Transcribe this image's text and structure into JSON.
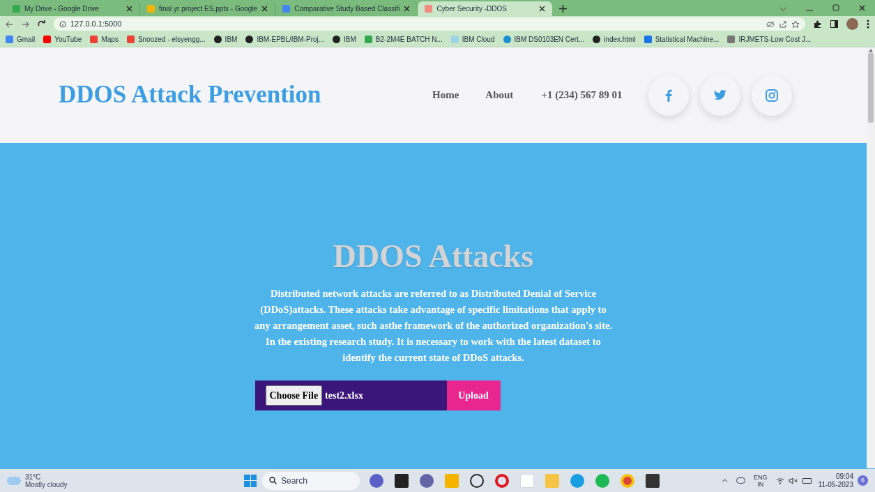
{
  "browser": {
    "tabs": [
      {
        "title": "My Drive - Google Drive",
        "selected": false
      },
      {
        "title": "final yr project ES.pptx - Google",
        "selected": false
      },
      {
        "title": "Comparative Study Based Classifi",
        "selected": false
      },
      {
        "title": "Cyber Security -DDOS",
        "selected": true
      }
    ],
    "address": "127.0.0.1:5000",
    "bookmarks": [
      "Gmail",
      "YouTube",
      "Maps",
      "Snoozed - elsyengg...",
      "IBM",
      "IBM-EPBL/IBM-Proj...",
      "IBM",
      "B2-2M4E BATCH N...",
      "IBM Cloud",
      "IBM DS0103EN Cert...",
      "index.html",
      "Statistical Machine...",
      "IRJMETS-Low Cost J..."
    ]
  },
  "header": {
    "brand": "DDOS Attack Prevention",
    "nav": [
      "Home",
      "About",
      "+1 (234) 567 89 01"
    ]
  },
  "hero": {
    "title": "DDOS Attacks",
    "text": "Distributed network attacks are referred to as Distributed Denial of Service (DDoS)attacks. These attacks take advantage of specific limitations that apply to any arrangement asset, such asthe framework of the authorized organization's site. In the existing research study. It is necessary to work with the latest dataset to identify the current state of DDoS attacks.",
    "file_button": "Choose File",
    "file_name": "test2.xlsx",
    "upload": "Upload"
  },
  "taskbar": {
    "temperature": "31°C",
    "weather": "Mostly cloudy",
    "search": "Search",
    "lang": "ENG",
    "region": "IN",
    "time": "09:04",
    "date": "11-05-2023",
    "badge": "6"
  }
}
